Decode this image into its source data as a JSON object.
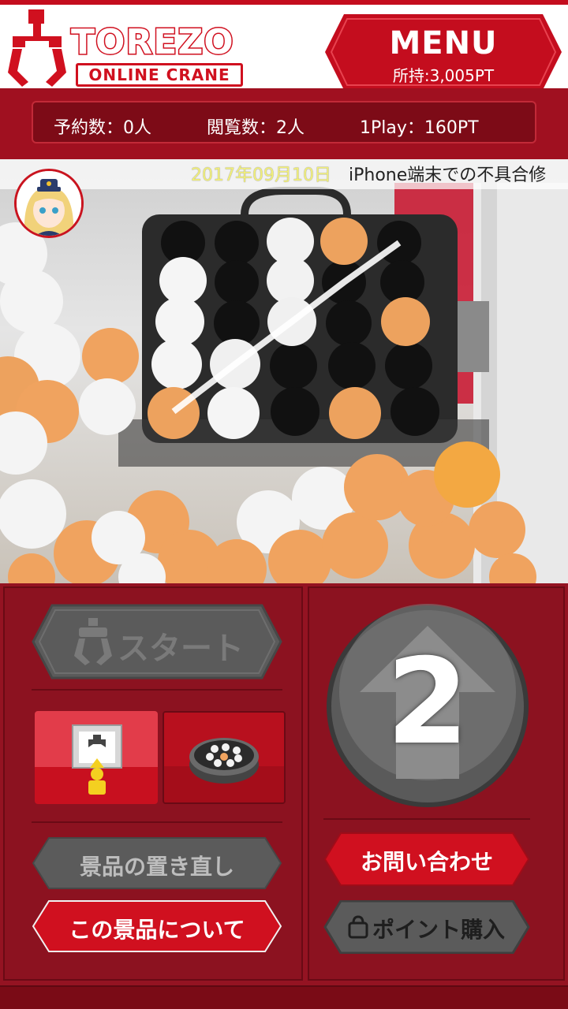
{
  "header": {
    "logo_brand": "TOREZO",
    "logo_sub": "ONLINE CRANE",
    "menu_label": "MENU",
    "points": "所持:3,005PT"
  },
  "stats": {
    "reservations": "予約数：0人",
    "viewers": "閲覧数：2人",
    "play_cost": "1Play：160PT"
  },
  "video": {
    "ticker_date": "2017年09月10日",
    "ticker_text": "iPhone端末での不具合修"
  },
  "controls": {
    "start_label": "スタート",
    "remaining_count": "2",
    "reposition_label": "景品の置き直し",
    "about_prize_label": "この景品について",
    "contact_label": "お問い合わせ",
    "buy_points_label": "ポイント購入"
  },
  "colors": {
    "brand_red": "#d0101f",
    "dark_red": "#8c1220",
    "disabled_gray": "#5b5b5b"
  }
}
